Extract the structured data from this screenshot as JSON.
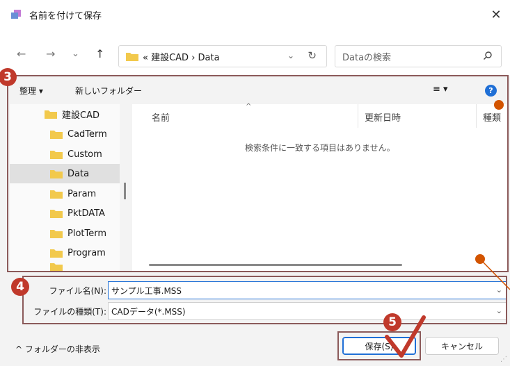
{
  "window": {
    "title": "名前を付けて保存",
    "close_label": "✕"
  },
  "nav": {
    "back": "←",
    "forward": "→",
    "recent": "⌄",
    "up": "↑",
    "address_crumbs": "« 建設CAD › Data",
    "address_chevron": "⌄",
    "refresh": "↻",
    "search_placeholder": "Dataの検索"
  },
  "toolbar": {
    "organize_label": "整理 ▾",
    "new_folder_label": "新しいフォルダー",
    "view_label": "≡ ▾",
    "help_label": "?"
  },
  "tree": {
    "items": [
      {
        "label": "建設CAD"
      },
      {
        "label": "CadTerm"
      },
      {
        "label": "Custom"
      },
      {
        "label": "Data"
      },
      {
        "label": "Param"
      },
      {
        "label": "PktDATA"
      },
      {
        "label": "PlotTerm"
      },
      {
        "label": "Program"
      }
    ]
  },
  "filelist": {
    "columns": [
      "名前",
      "更新日時",
      "種類"
    ],
    "empty_message": "検索条件に一致する項目はありません。"
  },
  "form": {
    "filename_label": "ファイル名(N):",
    "filename_value": "サンプル工事.MSS",
    "filetype_label": "ファイルの種類(T):",
    "filetype_value": "CADデータ(*.MSS)",
    "dropdown_glyph": "⌄"
  },
  "footer": {
    "hide_folders_label": "^ フォルダーの非表示",
    "save_label": "保存(S)",
    "cancel_label": "キャンセル"
  },
  "annotations": {
    "badge3": "3",
    "badge4": "4",
    "badge5": "5"
  },
  "colors": {
    "accent": "#1f6fd6",
    "badge": "#c0392b",
    "folder": "#f2c94c"
  }
}
